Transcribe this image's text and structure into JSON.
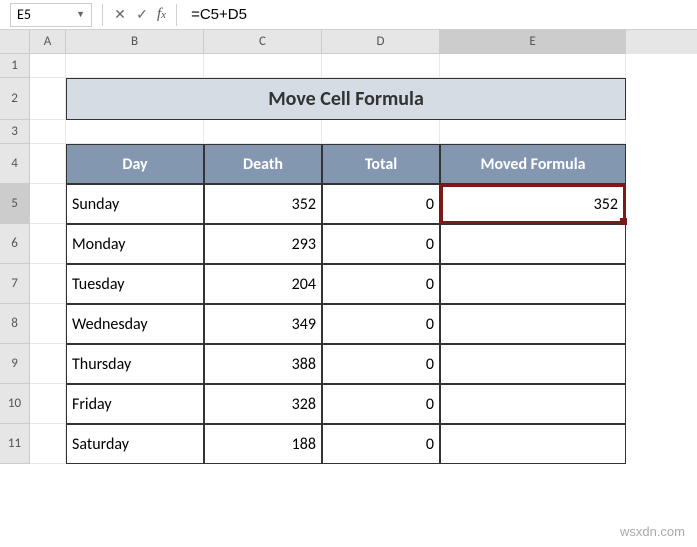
{
  "formula_bar": {
    "name_box": "E5",
    "formula": "=C5+D5"
  },
  "columns": [
    "A",
    "B",
    "C",
    "D",
    "E"
  ],
  "rows": [
    "1",
    "2",
    "3",
    "4",
    "5",
    "6",
    "7",
    "8",
    "9",
    "10",
    "11"
  ],
  "title": "Move Cell Formula",
  "headers": {
    "day": "Day",
    "death": "Death",
    "total": "Total",
    "moved": "Moved Formula"
  },
  "data": [
    {
      "day": "Sunday",
      "death": "352",
      "total": "0",
      "moved": "352"
    },
    {
      "day": "Monday",
      "death": "293",
      "total": "0",
      "moved": ""
    },
    {
      "day": "Tuesday",
      "death": "204",
      "total": "0",
      "moved": ""
    },
    {
      "day": "Wednesday",
      "death": "349",
      "total": "0",
      "moved": ""
    },
    {
      "day": "Thursday",
      "death": "388",
      "total": "0",
      "moved": ""
    },
    {
      "day": "Friday",
      "death": "328",
      "total": "0",
      "moved": ""
    },
    {
      "day": "Saturday",
      "death": "188",
      "total": "0",
      "moved": ""
    }
  ],
  "active_cell": {
    "row": 5,
    "col": "E"
  },
  "watermark": "wsxdn.com"
}
